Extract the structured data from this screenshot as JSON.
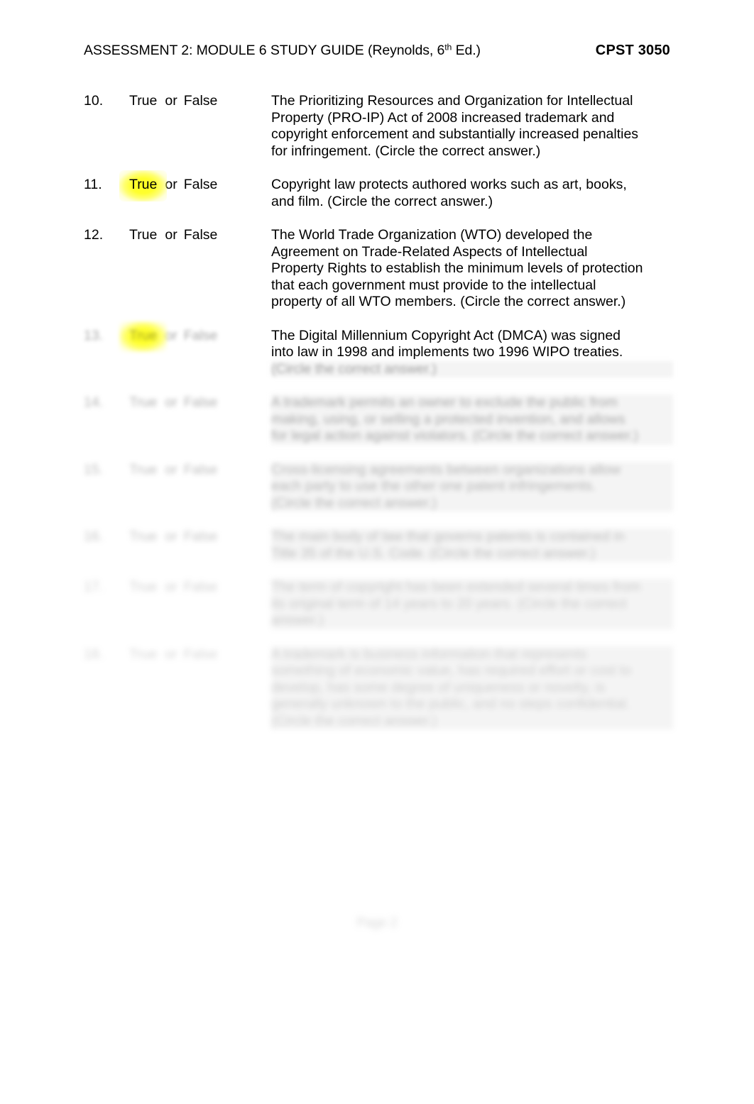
{
  "header": {
    "title_prefix": "ASSESSMENT 2: MODULE 6 STUDY GUIDE (Reynolds, 6",
    "title_superscript": "th",
    "title_suffix": " Ed.)",
    "course_code": "CPST 3050"
  },
  "labels": {
    "true": "True",
    "or": "or",
    "false": "False"
  },
  "highlight_color": "#ffff00",
  "questions": [
    {
      "number": "10.",
      "true_label": "True",
      "or_label": "or",
      "false_label": "False",
      "highlighted": false,
      "clarity": "clear",
      "lines": [
        "The Prioritizing Resources and Organization for Intellectual",
        "Property (PRO-IP) Act of 2008 increased trademark and",
        "copyright enforcement and substantially increased penalties",
        "for infringement.  (Circle the correct answer.)"
      ]
    },
    {
      "number": "11.",
      "true_label": "True",
      "or_label": "or",
      "false_label": "False",
      "highlighted": true,
      "clarity": "clear",
      "lines": [
        "Copyright law protects authored works such as art, books,",
        "and film.  (Circle the correct answer.)"
      ]
    },
    {
      "number": "12.",
      "true_label": "True",
      "or_label": "or",
      "false_label": "False",
      "highlighted": false,
      "clarity": "clear",
      "lines": [
        "The World Trade Organization (WTO) developed the",
        "Agreement on Trade-Related Aspects of Intellectual",
        "Property Rights to establish the minimum levels of protection",
        "that each government must provide to the intellectual",
        "property of all WTO members.  (Circle the correct answer.)"
      ]
    },
    {
      "number": "13.",
      "true_label": "True",
      "or_label": "or",
      "false_label": "False",
      "highlighted": true,
      "clarity": "partially-obscured",
      "lines": [
        "The Digital Millennium Copyright Act (DMCA) was signed",
        "into law in 1998 and implements two 1996 WIPO treaties."
      ],
      "obscured_lines": [
        "(Circle the correct answer.)"
      ]
    },
    {
      "number": "14.",
      "true_label": "True",
      "or_label": "or",
      "false_label": "False",
      "highlighted": false,
      "clarity": "obscured",
      "obscured_lines": [
        "A trademark permits an owner to exclude the public from",
        "making, using, or selling a protected invention, and allows",
        "for legal action against violators.  (Circle the correct answer.)"
      ]
    },
    {
      "number": "15.",
      "true_label": "True",
      "or_label": "or",
      "false_label": "False",
      "highlighted": false,
      "clarity": "obscured",
      "obscured_lines": [
        "Cross-licensing agreements between organizations allow",
        "each party to use the other one patent infringements.",
        "(Circle the correct answer.)"
      ]
    },
    {
      "number": "16.",
      "true_label": "True",
      "or_label": "or",
      "false_label": "False",
      "highlighted": false,
      "clarity": "obscured",
      "obscured_lines": [
        "The main body of law that governs patents is contained in",
        "Title 35 of the U.S. Code.  (Circle the correct answer.)"
      ]
    },
    {
      "number": "17.",
      "true_label": "True",
      "or_label": "or",
      "false_label": "False",
      "highlighted": false,
      "clarity": "obscured",
      "obscured_lines": [
        "The term of copyright has been extended several times from",
        "its original term of 14 years to 20 years.  (Circle the correct",
        "answer.)"
      ]
    },
    {
      "number": "18.",
      "true_label": "True",
      "or_label": "or",
      "false_label": "False",
      "highlighted": false,
      "clarity": "obscured",
      "obscured_lines": [
        "A trademark is business information that represents",
        "something of economic value, has required effort or cost to",
        "develop, has some degree of uniqueness or novelty, is",
        "generally unknown to the public, and no steps confidential.",
        "(Circle the correct answer.)"
      ]
    }
  ],
  "footer": {
    "page_marker": "Page 2"
  }
}
